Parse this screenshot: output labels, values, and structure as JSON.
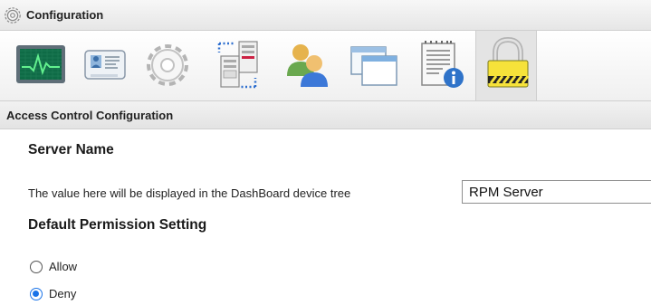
{
  "window": {
    "title": "Configuration",
    "icon": "gear-icon"
  },
  "toolbar": {
    "tools": [
      {
        "icon": "monitor-icon",
        "active": false
      },
      {
        "icon": "id-card-icon",
        "active": false
      },
      {
        "icon": "gear-icon",
        "active": false
      },
      {
        "icon": "server-network-icon",
        "active": false
      },
      {
        "icon": "users-icon",
        "active": false
      },
      {
        "icon": "windows-icon",
        "active": false
      },
      {
        "icon": "notepad-info-icon",
        "active": false
      },
      {
        "icon": "padlock-icon",
        "active": true
      }
    ]
  },
  "section": {
    "title": "Access Control Configuration"
  },
  "server_name": {
    "heading": "Server Name",
    "description": "The value here will be displayed in the DashBoard device tree",
    "value": "RPM Server"
  },
  "permission": {
    "heading": "Default Permission Setting",
    "options": [
      {
        "label": "Allow",
        "checked": false
      },
      {
        "label": "Deny",
        "checked": true
      }
    ]
  },
  "colors": {
    "accent": "#1a73e8",
    "monitor_screen": "#0f6b46",
    "lock_body": "#f6e23a"
  }
}
